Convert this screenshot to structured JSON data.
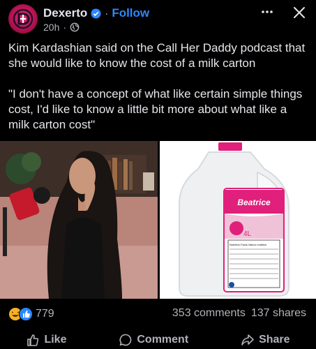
{
  "post": {
    "page_name": "Dexerto",
    "follow_label": "Follow",
    "dot_sep": "·",
    "time": "20h",
    "time_dot": "·",
    "caption_1": "Kim Kardashian said on the Call Her Daddy podcast that she would like to know the cost of a milk carton",
    "caption_2": "\"I don't have a concept of what like certain simple things cost, I'd like to know a little bit more about what like a milk carton cost\""
  },
  "images": {
    "right_brand": "Beatrice",
    "right_panel_text": "Nutrition Facts Valeur nutritive",
    "fat_label": "4L"
  },
  "engagement": {
    "reaction_count": "779",
    "comments": "353 comments",
    "shares": "137 shares"
  },
  "actions": {
    "like": "Like",
    "comment": "Comment",
    "share": "Share"
  },
  "colors": {
    "background": "#000000",
    "text": "#e4e6eb",
    "secondary": "#b0b3b8",
    "link": "#2d88ff"
  },
  "icons": [
    "dexerto-logo-icon",
    "verified-badge-icon",
    "globe-icon",
    "more-options-icon",
    "close-icon",
    "laugh-reaction-icon",
    "like-reaction-icon",
    "like-icon",
    "comment-icon",
    "share-icon"
  ]
}
